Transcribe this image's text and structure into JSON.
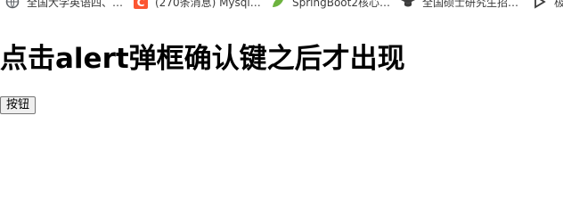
{
  "bookmarks": [
    {
      "label": "全国大学英语四、…",
      "icon": "globe-icon"
    },
    {
      "label": "(270条消息) Mysql…",
      "icon": "csdn-icon",
      "icon_color": "#fc5531"
    },
    {
      "label": "SpringBoot2核心…",
      "icon": "leaf-icon",
      "icon_color": "#6db33f"
    },
    {
      "label": "全国硕士研究生招…",
      "icon": "graduation-cap-icon"
    },
    {
      "label": "极",
      "icon": "bookmark-arrow-icon"
    }
  ],
  "page": {
    "title": "点击alert弹框确认键之后才出现",
    "button_label": "按钮"
  }
}
